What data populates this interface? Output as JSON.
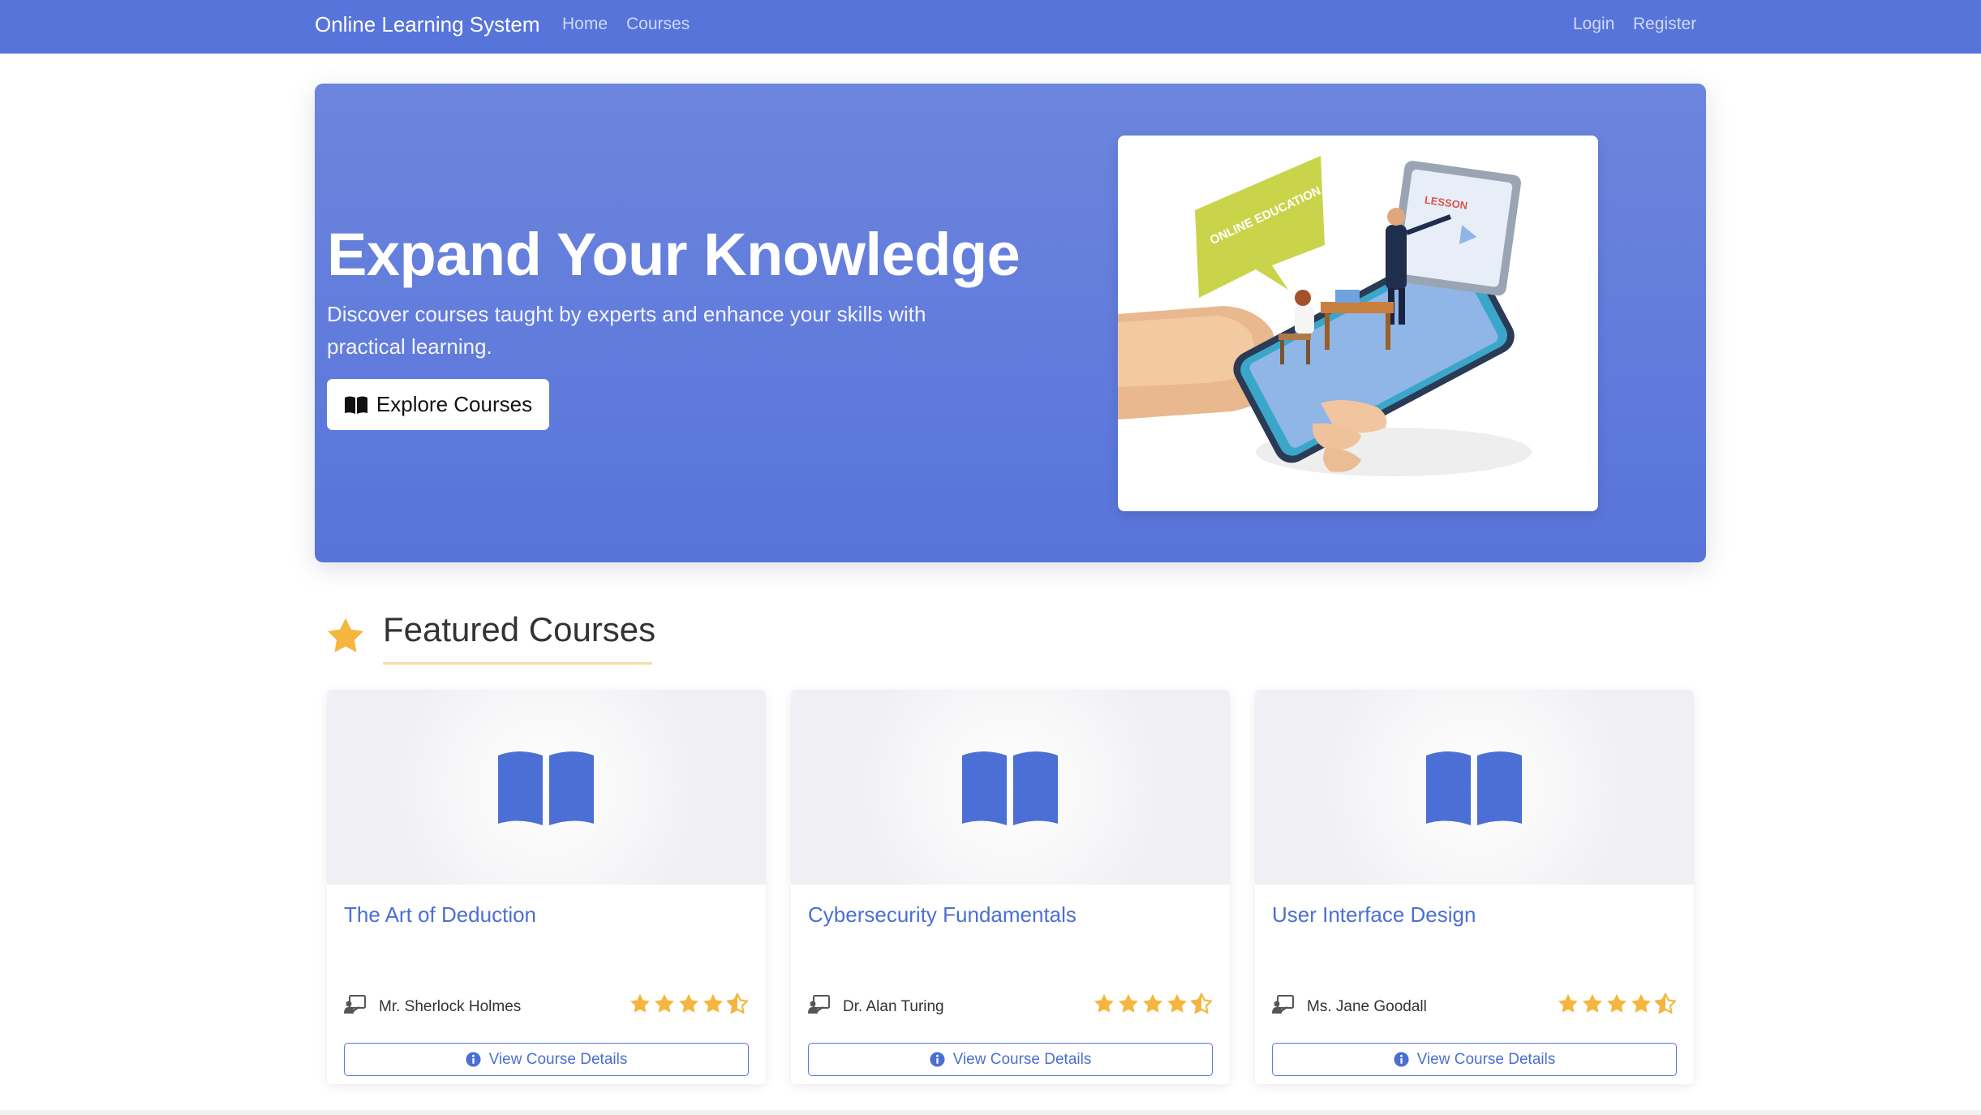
{
  "navbar": {
    "brand": "Online Learning System",
    "links": [
      "Home",
      "Courses"
    ],
    "auth": [
      "Login",
      "Register"
    ]
  },
  "hero": {
    "title": "Expand Your Knowledge",
    "subtitle": "Discover courses taught by experts and enhance your skills with practical learning.",
    "button_label": "Explore Courses",
    "button_icon": "book-open-icon",
    "image_text": {
      "bubble": "ONLINE EDUCATION",
      "screen": "LESSON"
    }
  },
  "featured": {
    "title": "Featured Courses",
    "icon": "star-icon"
  },
  "courses": [
    {
      "title": "The Art of Deduction",
      "instructor": "Mr. Sherlock Holmes",
      "rating": 4.5,
      "button_label": "View Course Details"
    },
    {
      "title": "Cybersecurity Fundamentals",
      "instructor": "Dr. Alan Turing",
      "rating": 4.5,
      "button_label": "View Course Details"
    },
    {
      "title": "User Interface Design",
      "instructor": "Ms. Jane Goodall",
      "rating": 4.5,
      "button_label": "View Course Details"
    }
  ],
  "colors": {
    "primary": "#5774db",
    "link": "#4b6fd4",
    "star": "#f4b63e",
    "card_image_bg": "#f0f0f4"
  }
}
